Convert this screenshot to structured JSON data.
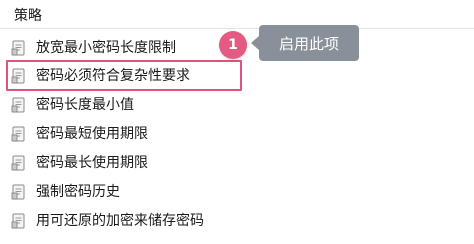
{
  "header": {
    "title": "策略"
  },
  "policies": [
    {
      "label": "放宽最小密码长度限制",
      "icon": "policy-icon"
    },
    {
      "label": "密码必须符合复杂性要求",
      "icon": "policy-icon"
    },
    {
      "label": "密码长度最小值",
      "icon": "policy-icon"
    },
    {
      "label": "密码最短使用期限",
      "icon": "policy-icon"
    },
    {
      "label": "密码最长使用期限",
      "icon": "policy-icon"
    },
    {
      "label": "强制密码历史",
      "icon": "policy-icon"
    },
    {
      "label": "用可还原的加密来储存密码",
      "icon": "policy-icon"
    }
  ],
  "annotation": {
    "step_number": "1",
    "callout_text": "启用此项",
    "highlight_color": "#e0527c",
    "badge_color": "#e45a82",
    "callout_color": "#8a9099"
  }
}
